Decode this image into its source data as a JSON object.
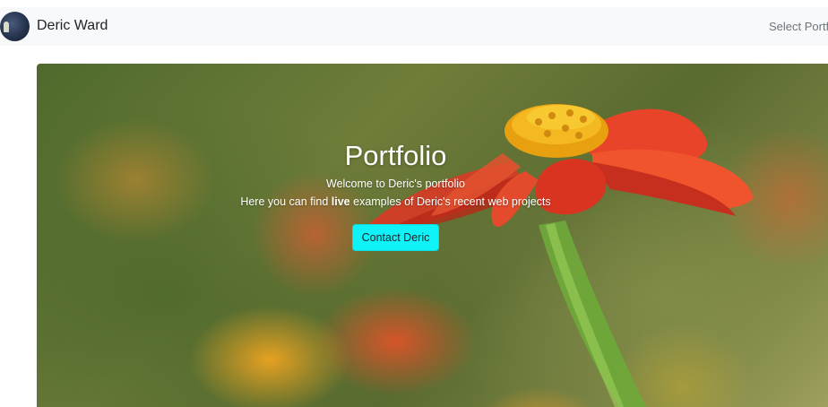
{
  "navbar": {
    "brand": "Deric Ward",
    "select_portfolio": "Select Portf"
  },
  "hero": {
    "title": "Portfolio",
    "welcome": "Welcome to Deric's portfolio",
    "line_prefix": "Here you can find ",
    "line_bold": "live",
    "line_suffix": " examples of Deric's recent web projects",
    "button_label": "Contact Deric"
  },
  "colors": {
    "navbar_bg": "#f8f9fa",
    "button_bg": "#0ff2f7",
    "text_dark": "#212529",
    "text_muted": "#6c757d"
  },
  "icons": {
    "avatar": "profile-photo"
  }
}
